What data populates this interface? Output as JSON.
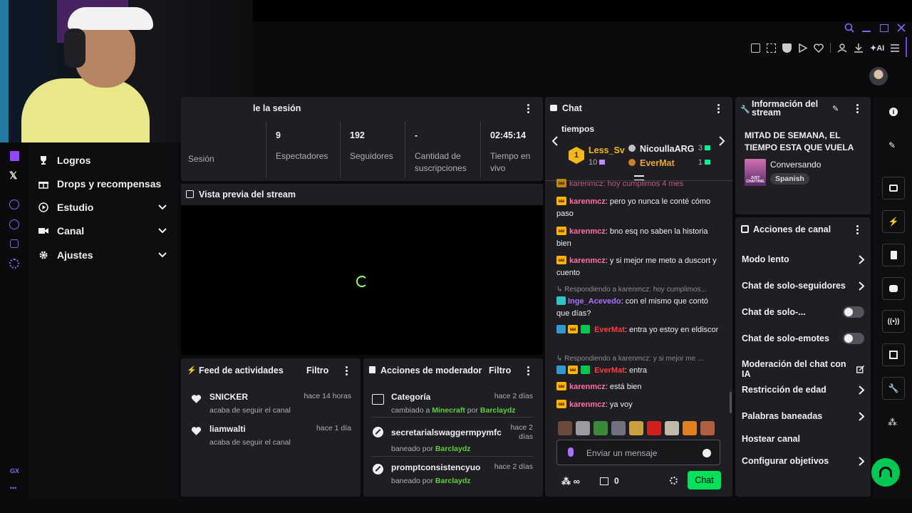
{
  "session": {
    "title": "le la sesión",
    "stats": [
      {
        "value": "",
        "label": "Sesión"
      },
      {
        "value": "9",
        "label": "Espectadores"
      },
      {
        "value": "192",
        "label": "Seguidores"
      },
      {
        "value": "-",
        "label": "Cantidad de suscripciones"
      },
      {
        "value": "02:45:14",
        "label": "Tiempo en vivo"
      }
    ]
  },
  "preview": {
    "title": "Vista previa del stream"
  },
  "left_menu": {
    "items": [
      {
        "label": "Logros",
        "icon": "trophy-icon"
      },
      {
        "label": "Drops y recompensas",
        "icon": "gift-icon"
      },
      {
        "label": "Estudio",
        "icon": "play-circle-icon"
      },
      {
        "label": "Canal",
        "icon": "video-icon"
      },
      {
        "label": "Ajustes",
        "icon": "gear-icon"
      }
    ],
    "footer_gx": "GX",
    "footer_more": "•••"
  },
  "feed": {
    "title": "Feed de actividades",
    "filter": "Filtro",
    "items": [
      {
        "user": "SNICKER",
        "time": "hace 14 horas",
        "action": "acaba de seguir el canal"
      },
      {
        "user": "liamwalti",
        "time": "hace 1 día",
        "action": "acaba de seguir el canal"
      }
    ]
  },
  "mod": {
    "title": "Acciones de moderador",
    "filter": "Filtro",
    "items": [
      {
        "title": "Categoría",
        "time": "hace 2 días",
        "line": [
          "cambiado a ",
          "Minecraft",
          " por ",
          "Barclaydz"
        ]
      },
      {
        "title": "secretarialswaggermpymfc",
        "time": "hace 2 días",
        "line": [
          "baneado por ",
          "Barclaydz"
        ]
      },
      {
        "title": "promptconsistencyuo",
        "time": "hace 2 días",
        "line": [
          "baneado por ",
          "Barclaydz"
        ]
      }
    ]
  },
  "chat": {
    "title": "Chat",
    "pinned_text": "tiempos",
    "leaderboard": [
      {
        "rank": "1",
        "name": "Less_Sv",
        "count": "10"
      },
      {
        "name": "NicoullaARG",
        "count": "3"
      },
      {
        "name": "EverMat",
        "count": "1"
      }
    ],
    "top_cut": "karenmcz: hoy cumplimos 4 mes",
    "messages": [
      {
        "user": "karenmcz",
        "text": ": pero yo nunca le conté cómo paso"
      },
      {
        "user": "karenmcz",
        "text": ": bno esq no saben la historia bien"
      },
      {
        "user": "karenmcz",
        "text": ": y si mejor me meto a duscort y cuento"
      },
      {
        "reply": "Respondiendo a karenmcz: hoy cumplimos...",
        "user": "Inge_Acevedo",
        "text": ": con el mismo que contó que días?"
      },
      {
        "user": "EverMat",
        "text": ": entra yo estoy en eldiscor"
      },
      {
        "reply": "Respondiendo a karenmcz: y si mejor me ...",
        "user": "EverMat",
        "text": ": entra"
      },
      {
        "user": "karenmcz",
        "text": ": está bien"
      },
      {
        "user": "karenmcz",
        "text": ": ya voy"
      }
    ],
    "placeholder": "Enviar un mensaje",
    "points": "∞",
    "store_count": "0",
    "send": "Chat"
  },
  "stream_info": {
    "title_line1": "Información del",
    "title_line2": "stream",
    "stream_title": "MITAD DE SEMANA, EL TIEMPO ESTA QUE VUELA",
    "category": "Conversando",
    "tag": "Spanish",
    "boxart_text": "JUST CHATTING"
  },
  "channel_actions": {
    "title": "Acciones de canal",
    "items": [
      {
        "label": "Modo lento",
        "control": "chevron"
      },
      {
        "label": "Chat de solo-seguidores",
        "control": "chevron"
      },
      {
        "label": "Chat de solo-...",
        "control": "toggle"
      },
      {
        "label": "Chat de solo-emotes",
        "control": "toggle"
      },
      {
        "label": "Moderación del chat con IA",
        "control": "external"
      },
      {
        "label": "Restricción de edad",
        "control": "chevron"
      },
      {
        "label": "Palabras baneadas",
        "control": "chevron"
      },
      {
        "label": "Hostear canal",
        "control": "none"
      },
      {
        "label": "Configurar objetivos",
        "control": "chevron"
      }
    ]
  },
  "browser_toolbar": {
    "ai_label": "AI"
  },
  "colors": {
    "panel": "#1f1f23",
    "accent_purple": "#9147ff",
    "chat_send": "#00e05a",
    "karenmcz": "#ff6fa4",
    "evermat": "#ff3b3b",
    "inge": "#a970ff",
    "fab": "#00c853"
  }
}
